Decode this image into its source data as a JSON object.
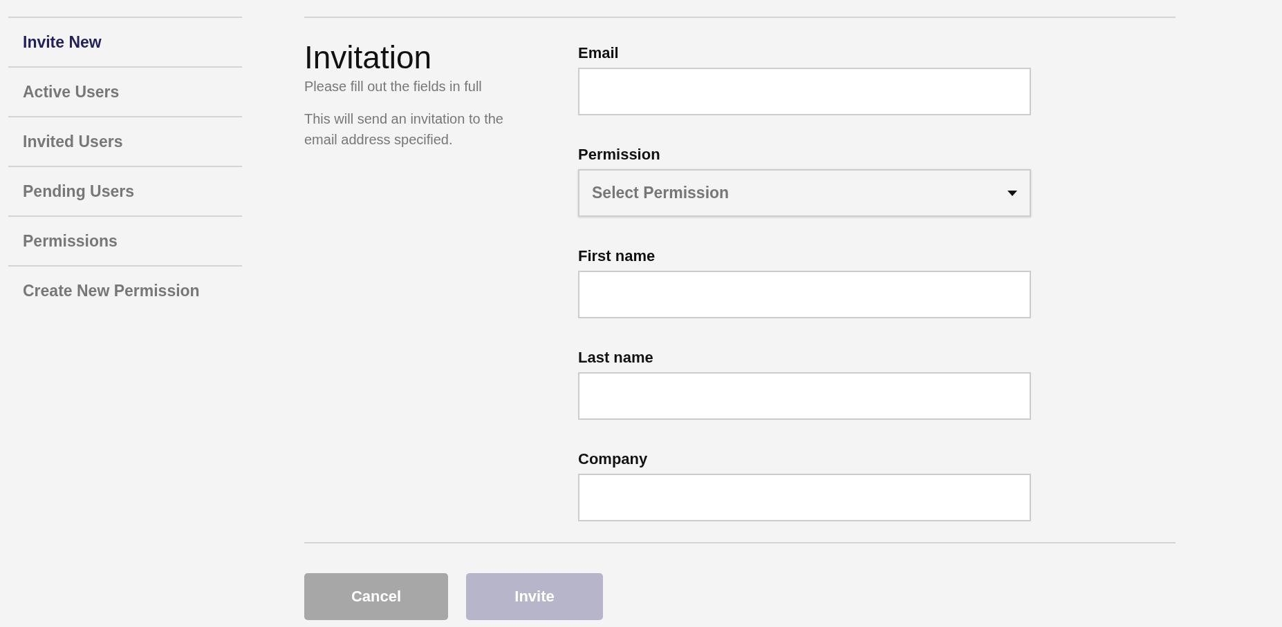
{
  "sidebar": {
    "items": [
      {
        "label": "Invite New",
        "selected": true
      },
      {
        "label": "Active Users",
        "selected": false
      },
      {
        "label": "Invited Users",
        "selected": false
      },
      {
        "label": "Pending Users",
        "selected": false
      },
      {
        "label": "Permissions",
        "selected": false
      },
      {
        "label": "Create New Permission",
        "selected": false
      }
    ]
  },
  "intro": {
    "title": "Invitation",
    "subtitle": "Please fill out the fields in full",
    "description": "This will send an invitation to the email address specified."
  },
  "form": {
    "fields": [
      {
        "kind": "text",
        "label": "Email"
      },
      {
        "kind": "select",
        "label": "Permission",
        "placeholder": "Select Permission"
      },
      {
        "kind": "text",
        "label": "First name"
      },
      {
        "kind": "text",
        "label": "Last name"
      },
      {
        "kind": "text",
        "label": "Company"
      }
    ]
  },
  "buttons": [
    {
      "kind": "secondary",
      "label": "Cancel",
      "disabled": false
    },
    {
      "kind": "primary",
      "label": "Invite",
      "disabled": true
    }
  ]
}
